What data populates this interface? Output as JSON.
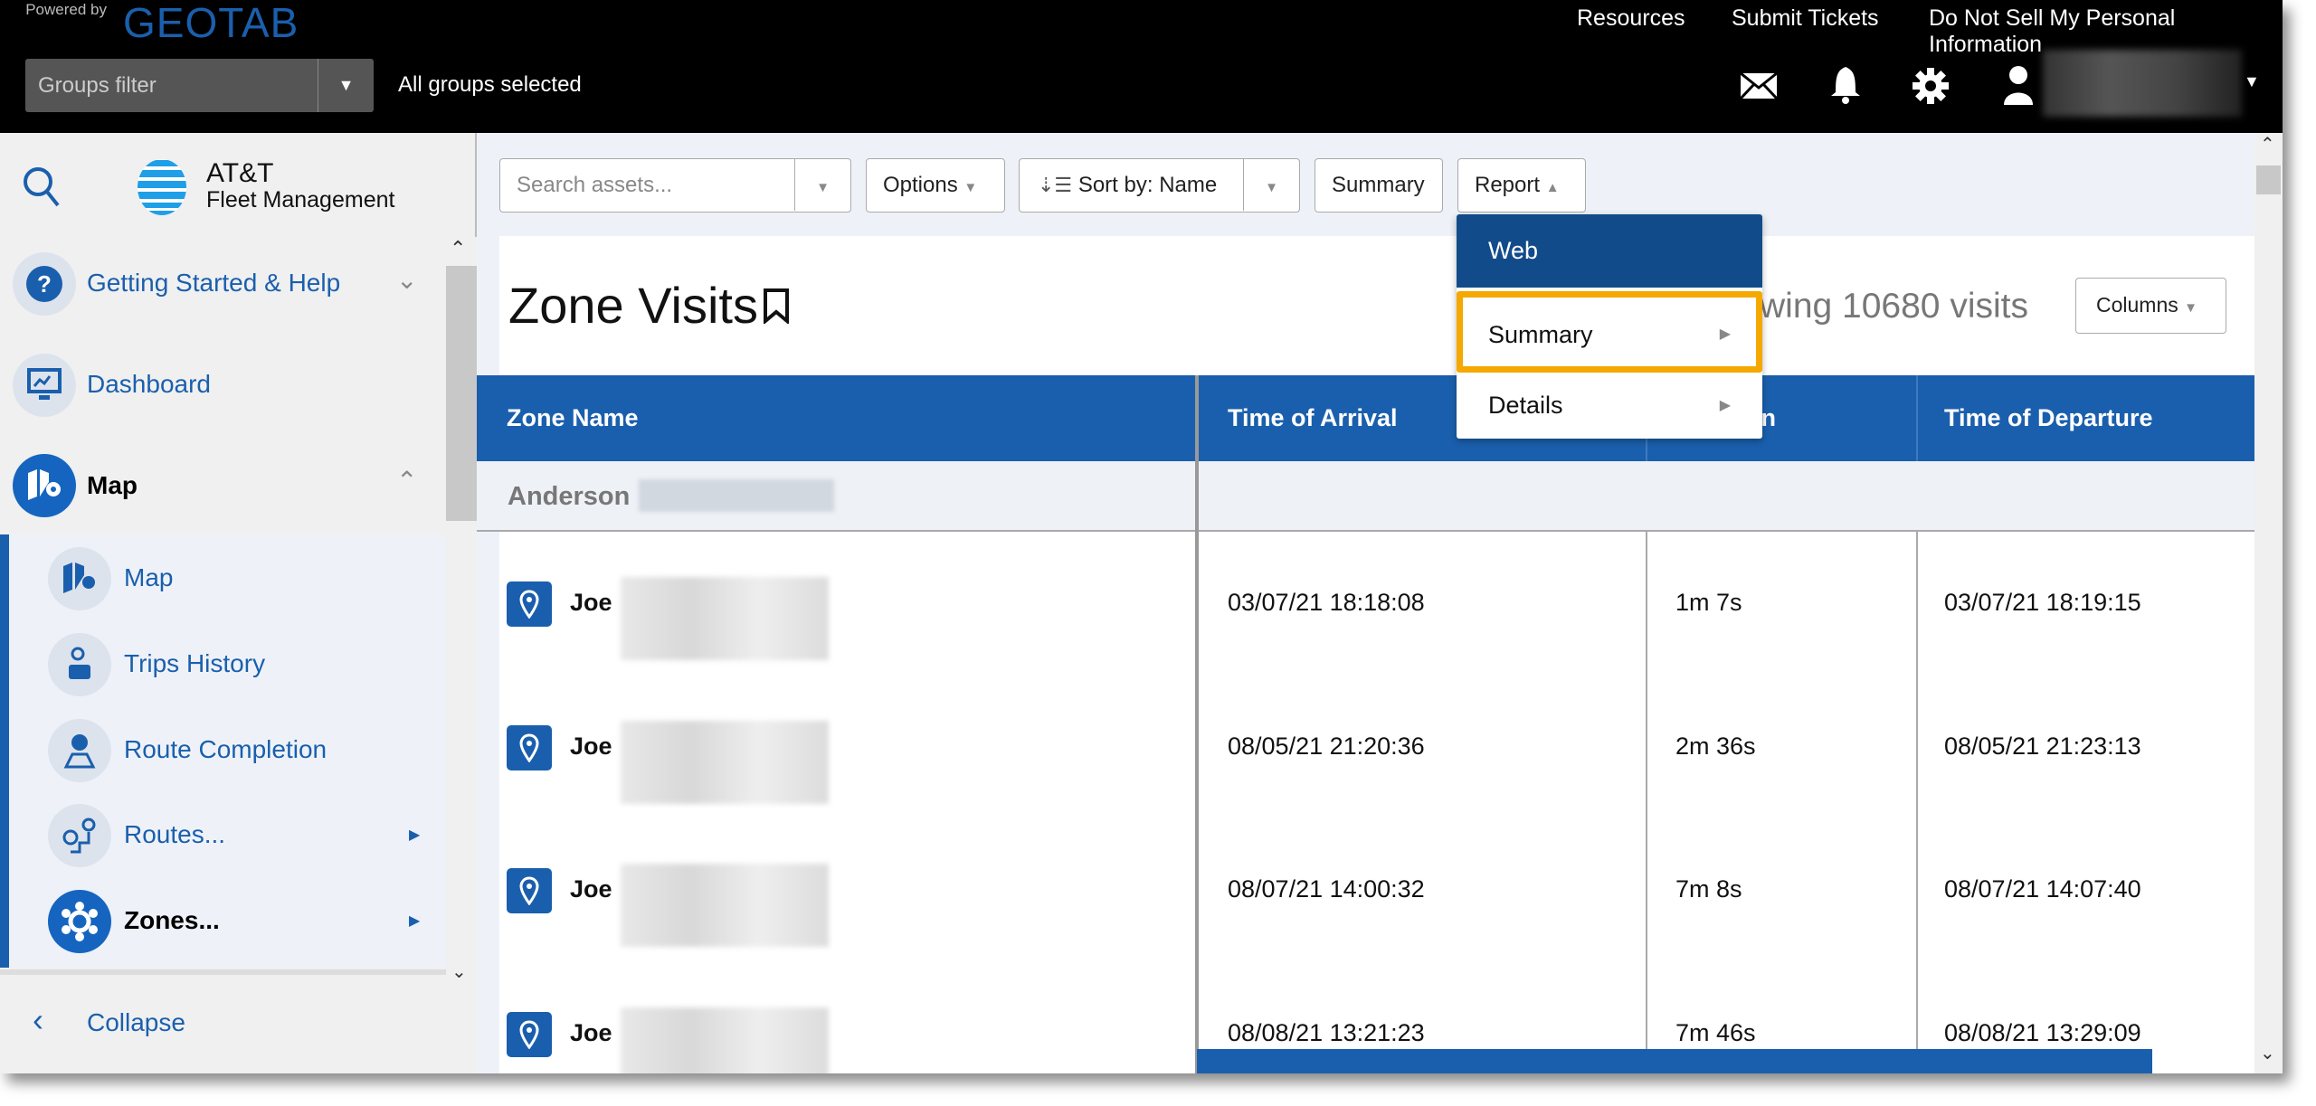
{
  "topbar": {
    "powered_by": "Powered by",
    "brand": "GEOTAB",
    "links": [
      "Resources",
      "Submit Tickets",
      "Do Not Sell My Personal Information"
    ],
    "groups_filter_placeholder": "Groups filter",
    "groups_status": "All groups selected",
    "icons": [
      "mail-icon",
      "bell-icon",
      "gear-icon",
      "user-icon"
    ]
  },
  "sidebar": {
    "logo_line1": "AT&T",
    "logo_line2": "Fleet Management",
    "items": [
      {
        "label": "Getting Started & Help",
        "icon": "help-icon"
      },
      {
        "label": "Dashboard",
        "icon": "dashboard-icon"
      },
      {
        "label": "Map",
        "icon": "map-icon"
      }
    ],
    "subitems": [
      {
        "label": "Map",
        "icon": "map-icon"
      },
      {
        "label": "Trips History",
        "icon": "trips-history-icon"
      },
      {
        "label": "Route Completion",
        "icon": "route-completion-icon"
      },
      {
        "label": "Routes...",
        "icon": "routes-icon"
      },
      {
        "label": "Zones...",
        "icon": "zones-icon"
      }
    ],
    "collapse": "Collapse"
  },
  "toolbar": {
    "search_placeholder": "Search assets...",
    "options": "Options",
    "sort_by": "Sort by:",
    "sort_value": "Name",
    "summary": "Summary",
    "report": "Report"
  },
  "report_menu": {
    "items": [
      "Web",
      "Summary",
      "Details"
    ],
    "highlighted": "Summary"
  },
  "page": {
    "title": "Zone Visits",
    "count_text": "Showing 10680 visits",
    "columns": "Columns"
  },
  "table": {
    "headers": [
      "Zone Name",
      "Time of Arrival",
      "Duration",
      "Time of Departure"
    ],
    "group": "Anderson",
    "rows": [
      {
        "zone": "Joe",
        "arrival": "03/07/21 18:18:08",
        "duration": "1m 7s",
        "departure": "03/07/21 18:19:15"
      },
      {
        "zone": "Joe",
        "arrival": "08/05/21 21:20:36",
        "duration": "2m 36s",
        "departure": "08/05/21 21:23:13"
      },
      {
        "zone": "Joe",
        "arrival": "08/07/21 14:00:32",
        "duration": "7m 8s",
        "departure": "08/07/21 14:07:40"
      },
      {
        "zone": "Joe",
        "arrival": "08/08/21 13:21:23",
        "duration": "7m 46s",
        "departure": "08/08/21 13:29:09"
      }
    ]
  },
  "colors": {
    "accent": "#1a5fad",
    "highlight": "#f5a800",
    "menu_active": "#124b8a"
  }
}
